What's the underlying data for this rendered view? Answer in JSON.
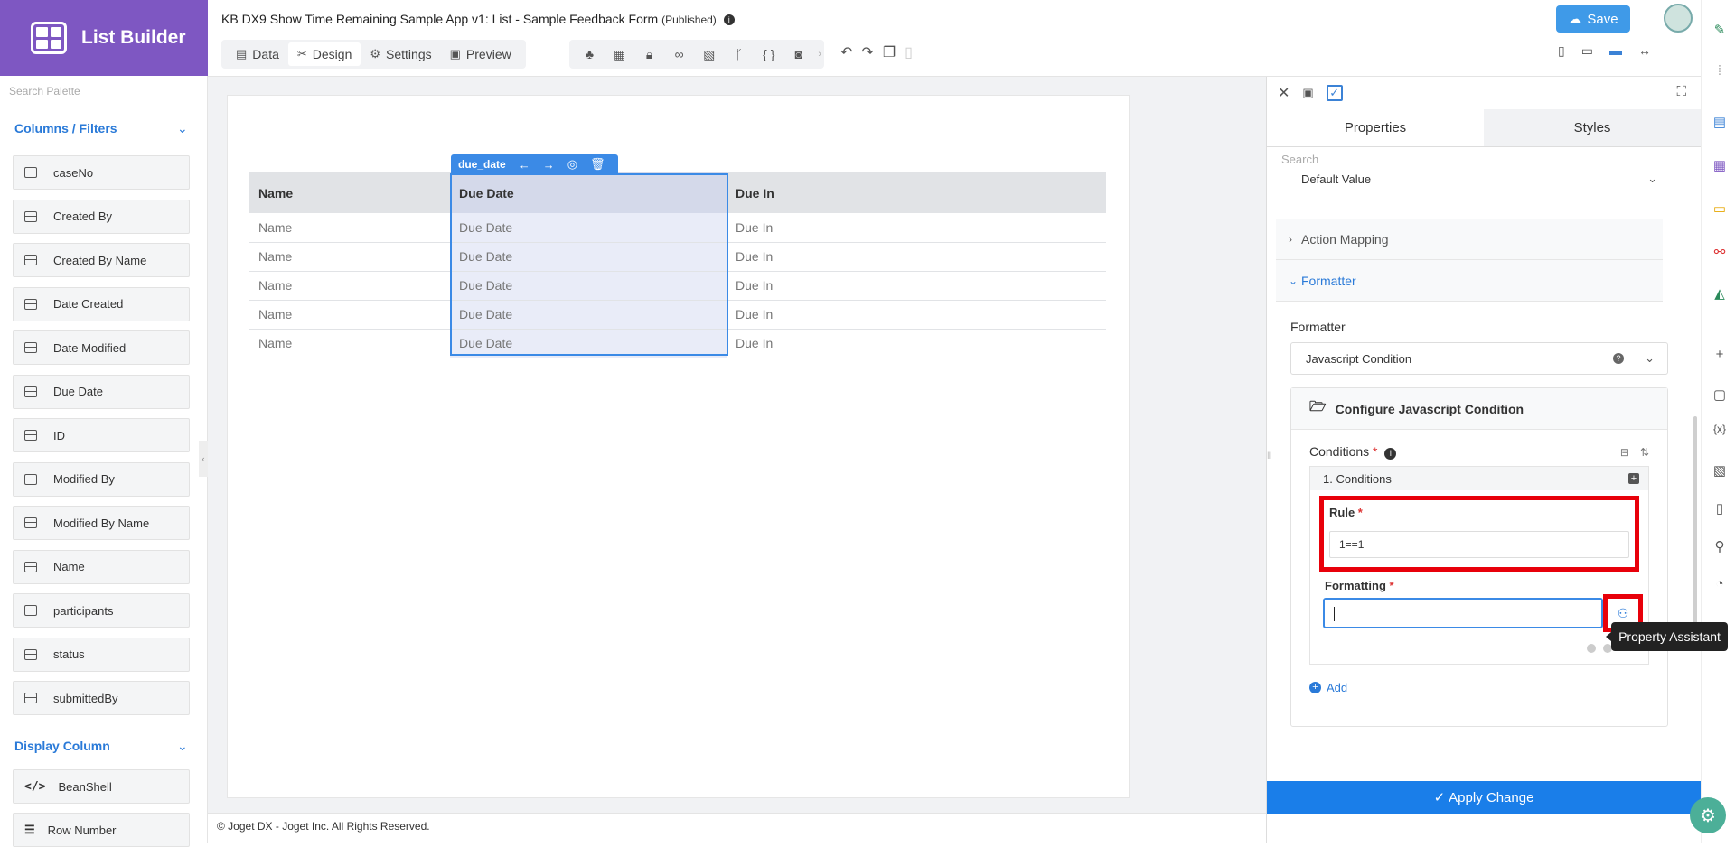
{
  "app": {
    "name": "List Builder",
    "title": "KB DX9 Show Time Remaining Sample App v1: List - Sample Feedback Form",
    "status": "(Published)"
  },
  "nav_tabs": [
    {
      "label": "Data",
      "icon": "table-icon"
    },
    {
      "label": "Design",
      "icon": "design-icon"
    },
    {
      "label": "Settings",
      "icon": "gear-icon"
    },
    {
      "label": "Preview",
      "icon": "preview-icon"
    }
  ],
  "header": {
    "save_label": "Save"
  },
  "palette": {
    "search_placeholder": "Search Palette",
    "section1": "Columns / Filters",
    "columns": [
      "caseNo",
      "Created By",
      "Created By Name",
      "Date Created",
      "Date Modified",
      "Due Date",
      "ID",
      "Modified By",
      "Modified By Name",
      "Name",
      "participants",
      "status",
      "submittedBy"
    ],
    "section2": "Display Column",
    "display": [
      "BeanShell",
      "Row Number"
    ]
  },
  "canvas": {
    "selected_column": "due_date",
    "headers": [
      "Name",
      "Due Date",
      "Due In"
    ],
    "rows": [
      [
        "Name",
        "Due Date",
        "Due In"
      ],
      [
        "Name",
        "Due Date",
        "Due In"
      ],
      [
        "Name",
        "Due Date",
        "Due In"
      ],
      [
        "Name",
        "Due Date",
        "Due In"
      ],
      [
        "Name",
        "Due Date",
        "Due In"
      ]
    ]
  },
  "footer": "© Joget DX - Joget Inc. All Rights Reserved.",
  "panel": {
    "tab_properties": "Properties",
    "tab_styles": "Styles",
    "search_placeholder": "Search",
    "default_value": "Default Value",
    "action_mapping": "Action Mapping",
    "formatter_section": "Formatter",
    "formatter_label": "Formatter",
    "formatter_value": "Javascript Condition",
    "configure_title": "Configure Javascript Condition",
    "conditions_label": "Conditions",
    "condition_item": "1. Conditions",
    "rule_label": "Rule",
    "rule_value": "1==1",
    "formatting_label": "Formatting",
    "add_label": "Add",
    "apply_label": "Apply Change"
  },
  "tooltip": "Property Assistant"
}
